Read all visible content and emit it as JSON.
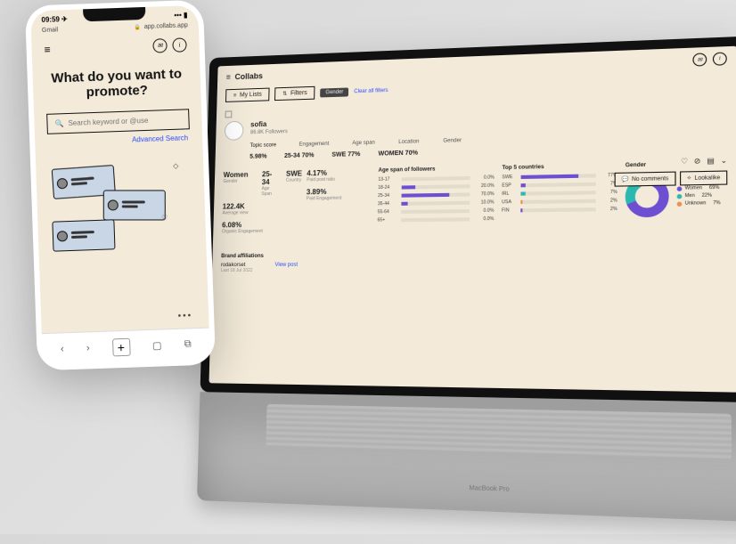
{
  "phone": {
    "status_time": "09:59 ✈",
    "status_net": "Gmail",
    "url": "app.collabs.app",
    "title": "What do you want to promote?",
    "search_placeholder": "Search keyword or @use",
    "advanced": "Advanced Search"
  },
  "laptop": {
    "logo": "Collabs",
    "tabs": {
      "my_lists": "My Lists",
      "filters": "Filters"
    },
    "chip": "Gender",
    "clear": "Clear all filters",
    "profile": {
      "name": "sofia",
      "followers": "86.8K Followers"
    },
    "metric_tabs": [
      "Topic score",
      "Engagement",
      "Age span",
      "Location",
      "Gender"
    ],
    "stats_bar": [
      "5.98%",
      "25-34 70%",
      "SWE 77%",
      "WOMEN 70%"
    ],
    "summary": {
      "women": {
        "label": "Gender",
        "value": "Women"
      },
      "age": {
        "label": "Age Span",
        "value": "25-34"
      },
      "country": {
        "label": "Country",
        "value": "SWE"
      },
      "avg_view": {
        "label": "Average view",
        "value": "122.4K"
      },
      "org_eng": {
        "label": "Organic Engagement",
        "value": "6.08%"
      }
    },
    "paid": {
      "ratio": {
        "label": "Paid post ratio",
        "value": "4.17%"
      },
      "eng": {
        "label": "Paid Engagement",
        "value": "3.89%"
      }
    },
    "brand": {
      "title": "Brand affiliations",
      "name": "rodakorset",
      "date": "Last 18 Jul 2022",
      "link": "View post"
    },
    "actions": {
      "no_comments": "No comments",
      "lookalike": "Lookalike"
    },
    "macbook": "MacBook Pro"
  },
  "chart_data": [
    {
      "type": "bar",
      "title": "Age span of followers",
      "orientation": "horizontal",
      "categories": [
        "13-17",
        "18-24",
        "25-34",
        "35-44",
        "55-64",
        "65+"
      ],
      "values": [
        0,
        20.0,
        70.0,
        10.0,
        0,
        0
      ],
      "xlabel": "",
      "ylabel": "",
      "xlim": [
        0,
        100
      ]
    },
    {
      "type": "bar",
      "title": "Top 5 countries",
      "orientation": "horizontal",
      "categories": [
        "SWE",
        "ESP",
        "IRL",
        "USA",
        "FIN"
      ],
      "values": [
        77,
        7,
        7,
        2,
        2
      ],
      "xlabel": "",
      "ylabel": "",
      "xlim": [
        0,
        100
      ]
    },
    {
      "type": "pie",
      "title": "Gender",
      "series": [
        {
          "name": "Women",
          "value": 69
        },
        {
          "name": "Men",
          "value": 22
        },
        {
          "name": "Unknown",
          "value": 7
        }
      ]
    }
  ]
}
